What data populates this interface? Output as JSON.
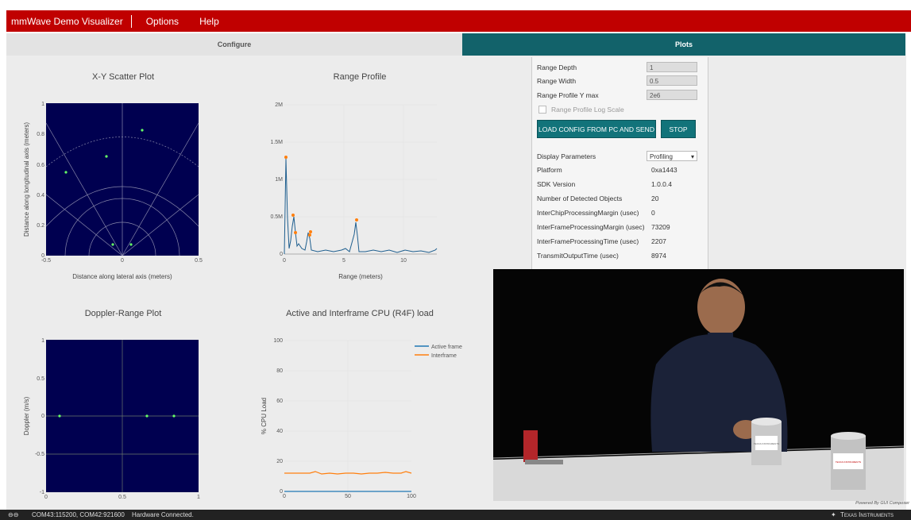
{
  "menubar": {
    "app_title": "mmWave Demo Visualizer",
    "options": "Options",
    "help": "Help"
  },
  "tabs": {
    "configure": "Configure",
    "plots": "Plots"
  },
  "scatter": {
    "title": "X-Y Scatter Plot",
    "xlabel": "Distance along lateral axis (meters)",
    "ylabel": "Distance along longitudinal axis (meters)",
    "xticks": [
      "-0.5",
      "0",
      "0.5"
    ],
    "yticks": [
      "1",
      "0.8",
      "0.6",
      "0.4",
      "0.2",
      "0"
    ]
  },
  "range_profile": {
    "title": "Range Profile",
    "xlabel": "Range (meters)",
    "xticks": [
      "0",
      "5",
      "10"
    ],
    "yticks": [
      "2M",
      "1.5M",
      "1M",
      "0.5M",
      "0"
    ]
  },
  "doppler": {
    "title": "Doppler-Range Plot",
    "ylabel": "Doppler (m/s)",
    "xticks": [
      "0",
      "0.5",
      "1"
    ],
    "yticks": [
      "1",
      "0.5",
      "0",
      "-0.5",
      "-1"
    ]
  },
  "cpu": {
    "title": "Active and Interframe CPU (R4F) load",
    "ylabel": "% CPU Load",
    "xticks": [
      "0",
      "50",
      "100"
    ],
    "yticks": [
      "100",
      "80",
      "60",
      "40",
      "20",
      "0"
    ],
    "legend_active": "Active frame",
    "legend_inter": "Interframe"
  },
  "settings": {
    "range_depth_label": "Range Depth",
    "range_depth_value": "1",
    "range_width_label": "Range Width",
    "range_width_value": "0.5",
    "range_ymax_label": "Range Profile Y max",
    "range_ymax_value": "2e6",
    "log_scale_label": "Range Profile Log Scale",
    "load_button": "LOAD CONFIG FROM PC AND SEND",
    "stop_button": "STOP",
    "display_params_label": "Display Parameters",
    "display_params_value": "Profiling",
    "platform_label": "Platform",
    "platform_value": "0xa1443",
    "sdk_label": "SDK Version",
    "sdk_value": "1.0.0.4",
    "objects_label": "Number of Detected Objects",
    "objects_value": "20",
    "interchip_label": "InterChipProcessingMargin (usec)",
    "interchip_value": "0",
    "ifmargin_label": "InterFrameProcessingMargin (usec)",
    "ifmargin_value": "73209",
    "iftime_label": "InterFrameProcessingTime (usec)",
    "iftime_value": "2207",
    "tx_label": "TransmitOutputTime (usec)",
    "tx_value": "8974"
  },
  "video": {
    "credit": "Powered By GUI Composer",
    "can_label_1": "TEXAS INSTRUMENTS",
    "can_label_2": "TEXAS INSTRUMENTS"
  },
  "status": {
    "ports": "COM43:115200, COM42:921600",
    "connection": "Hardware Connected.",
    "brand": "Texas Instruments"
  },
  "colors": {
    "red": "#c00000",
    "teal": "#12626a",
    "plot_bg": "#000050",
    "active": "#1f77b4",
    "interframe": "#ff7f0e"
  }
}
